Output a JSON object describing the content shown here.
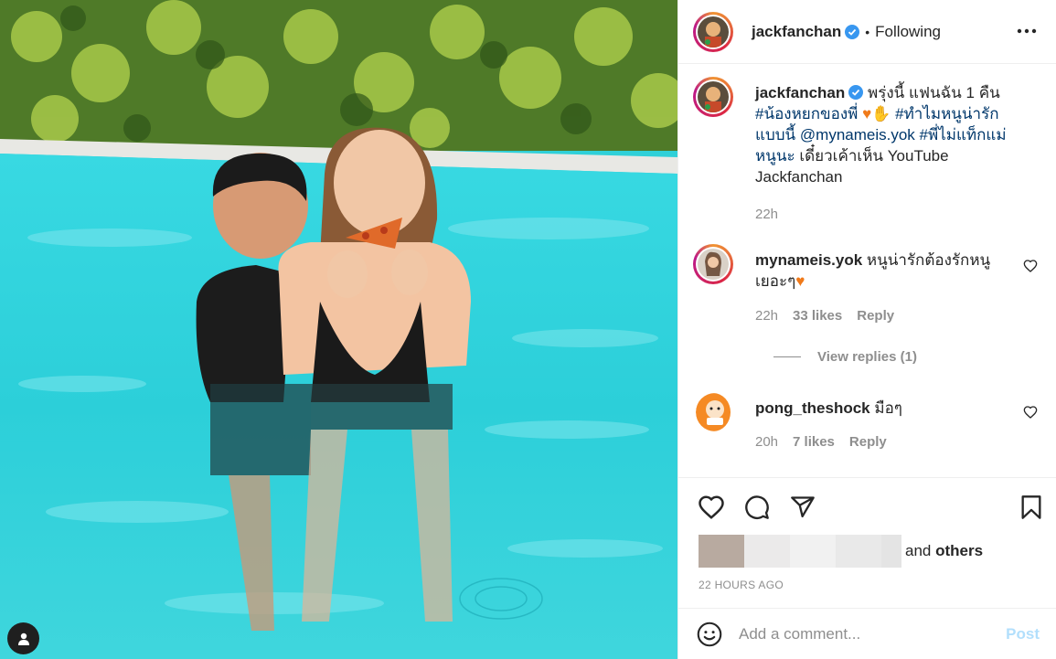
{
  "photo": {
    "description_icon": "user-tag-icon"
  },
  "header": {
    "username": "jackfanchan",
    "separator": "•",
    "follow_status": "Following",
    "more_icon": "ellipsis-icon"
  },
  "caption": {
    "username": "jackfanchan",
    "line1": "พรุ่งนี้ แฟนฉัน 1 คืน",
    "hashtag1": "#น้องหยกของพี่",
    "hashtag2": "#ทำไมหนูน่ารักแบบนี้",
    "mention": "@mynameis.yok",
    "hashtag3": "#พี่ไม่แท็กแม่หนูนะ",
    "line_end": "เดี๋ยวเค้าเห็น YouTube Jackfanchan",
    "time": "22h"
  },
  "comments": [
    {
      "username": "mynameis.yok",
      "text": "หนูน่ารักต้องรักหนูเยอะๆ",
      "time": "22h",
      "likes": "33 likes",
      "reply": "Reply",
      "view_replies": "View replies (1)"
    },
    {
      "username": "pong_theshock",
      "text": "มือๆ",
      "time": "20h",
      "likes": "7 likes",
      "reply": "Reply"
    }
  ],
  "actions": {
    "like_icon": "heart-icon",
    "comment_icon": "comment-icon",
    "share_icon": "send-icon",
    "save_icon": "bookmark-icon"
  },
  "likes": {
    "and_text": "and",
    "others_text": "others"
  },
  "timestamp": "22 HOURS AGO",
  "add_comment": {
    "placeholder": "Add a comment...",
    "post_label": "Post",
    "emoji_icon": "smiley-icon"
  },
  "colors": {
    "link": "#00376b",
    "secondary_text": "#8e8e8e",
    "verified": "#3897f0",
    "post_disabled": "#b2dffc",
    "pool": "#2fd0d8"
  }
}
